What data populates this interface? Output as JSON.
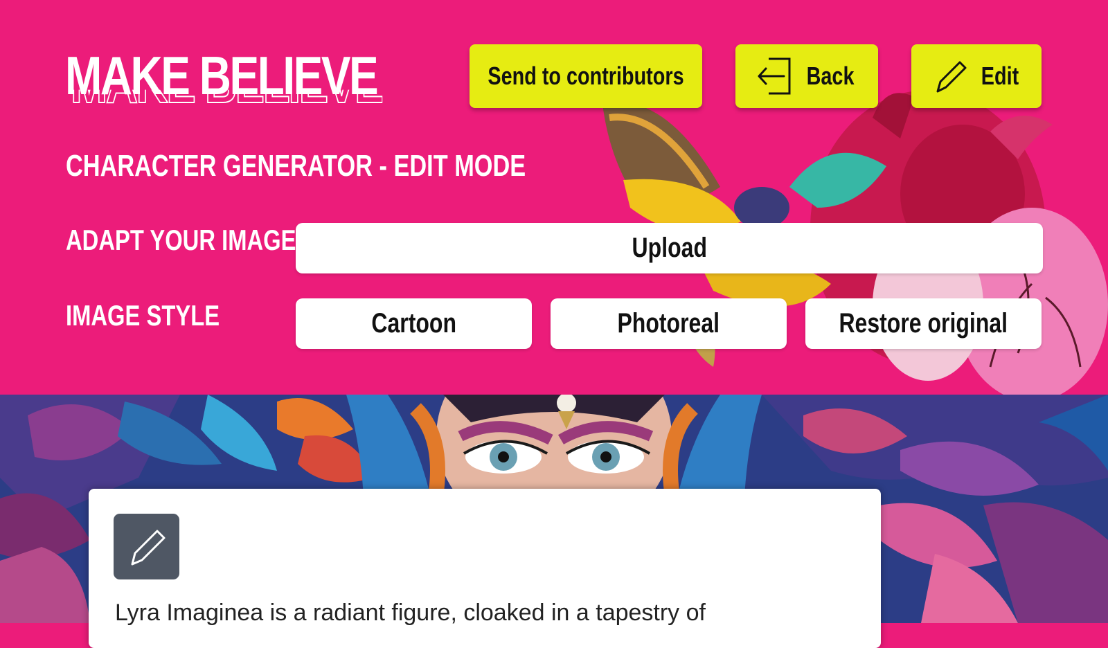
{
  "brand": {
    "logo_text": "MAKE BELIEVE"
  },
  "toolbar": {
    "send_label": "Send to contributors",
    "back_label": "Back",
    "edit_label": "Edit"
  },
  "page": {
    "subtitle": "CHARACTER GENERATOR  - EDIT MODE"
  },
  "adapt": {
    "label": "ADAPT YOUR IMAGE",
    "upload_label": "Upload"
  },
  "style": {
    "label": "IMAGE STYLE",
    "options": [
      "Cartoon",
      "Photoreal",
      "Restore original"
    ]
  },
  "character": {
    "description": "Lyra Imaginea is a radiant figure, cloaked in a tapestry of"
  },
  "colors": {
    "brand_pink": "#ec1c7a",
    "button_yellow": "#e6ec12",
    "edit_square": "#4f5764"
  },
  "icons": [
    "back-arrow-icon",
    "pencil-icon"
  ]
}
